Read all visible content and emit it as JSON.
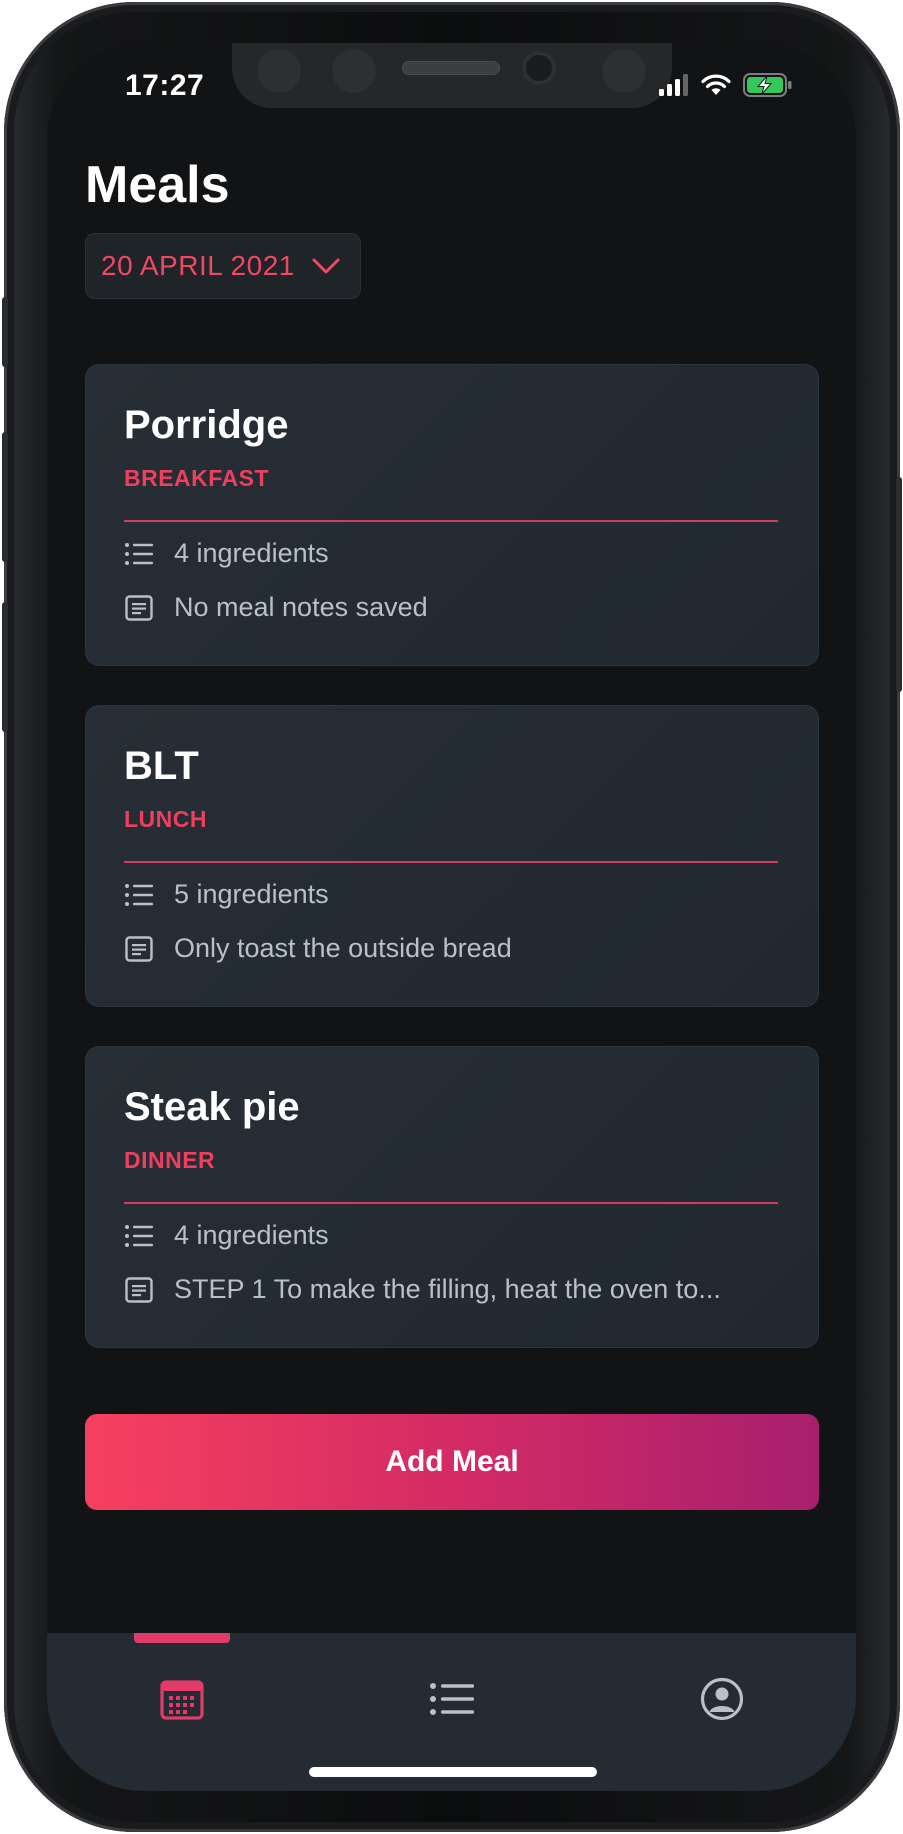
{
  "status_bar": {
    "time": "17:27",
    "icons": [
      "cellular-signal-icon",
      "wifi-icon",
      "battery-charging-icon"
    ]
  },
  "header": {
    "title": "Meals"
  },
  "date_picker": {
    "value": "20 APRIL 2021",
    "icon": "chevron-down-icon"
  },
  "meals": [
    {
      "name": "Porridge",
      "type": "BREAKFAST",
      "ingredients": "4 ingredients",
      "notes": "No meal notes saved"
    },
    {
      "name": "BLT",
      "type": "LUNCH",
      "ingredients": "5 ingredients",
      "notes": "Only toast the outside bread"
    },
    {
      "name": "Steak pie",
      "type": "DINNER",
      "ingredients": "4 ingredients",
      "notes": "STEP 1 To make the filling, heat the oven to..."
    }
  ],
  "actions": {
    "add_meal_label": "Add Meal"
  },
  "tab_bar": {
    "tabs": [
      {
        "icon": "calendar-icon",
        "active": true
      },
      {
        "icon": "list-icon",
        "active": false
      },
      {
        "icon": "profile-icon",
        "active": false
      }
    ]
  },
  "colors": {
    "accent": "#ef3f5f",
    "background": "#111315",
    "card": "#242b32",
    "button_gradient_start": "#f6405f",
    "button_gradient_end": "#a81f6e",
    "muted_text": "#b9c0c6"
  }
}
